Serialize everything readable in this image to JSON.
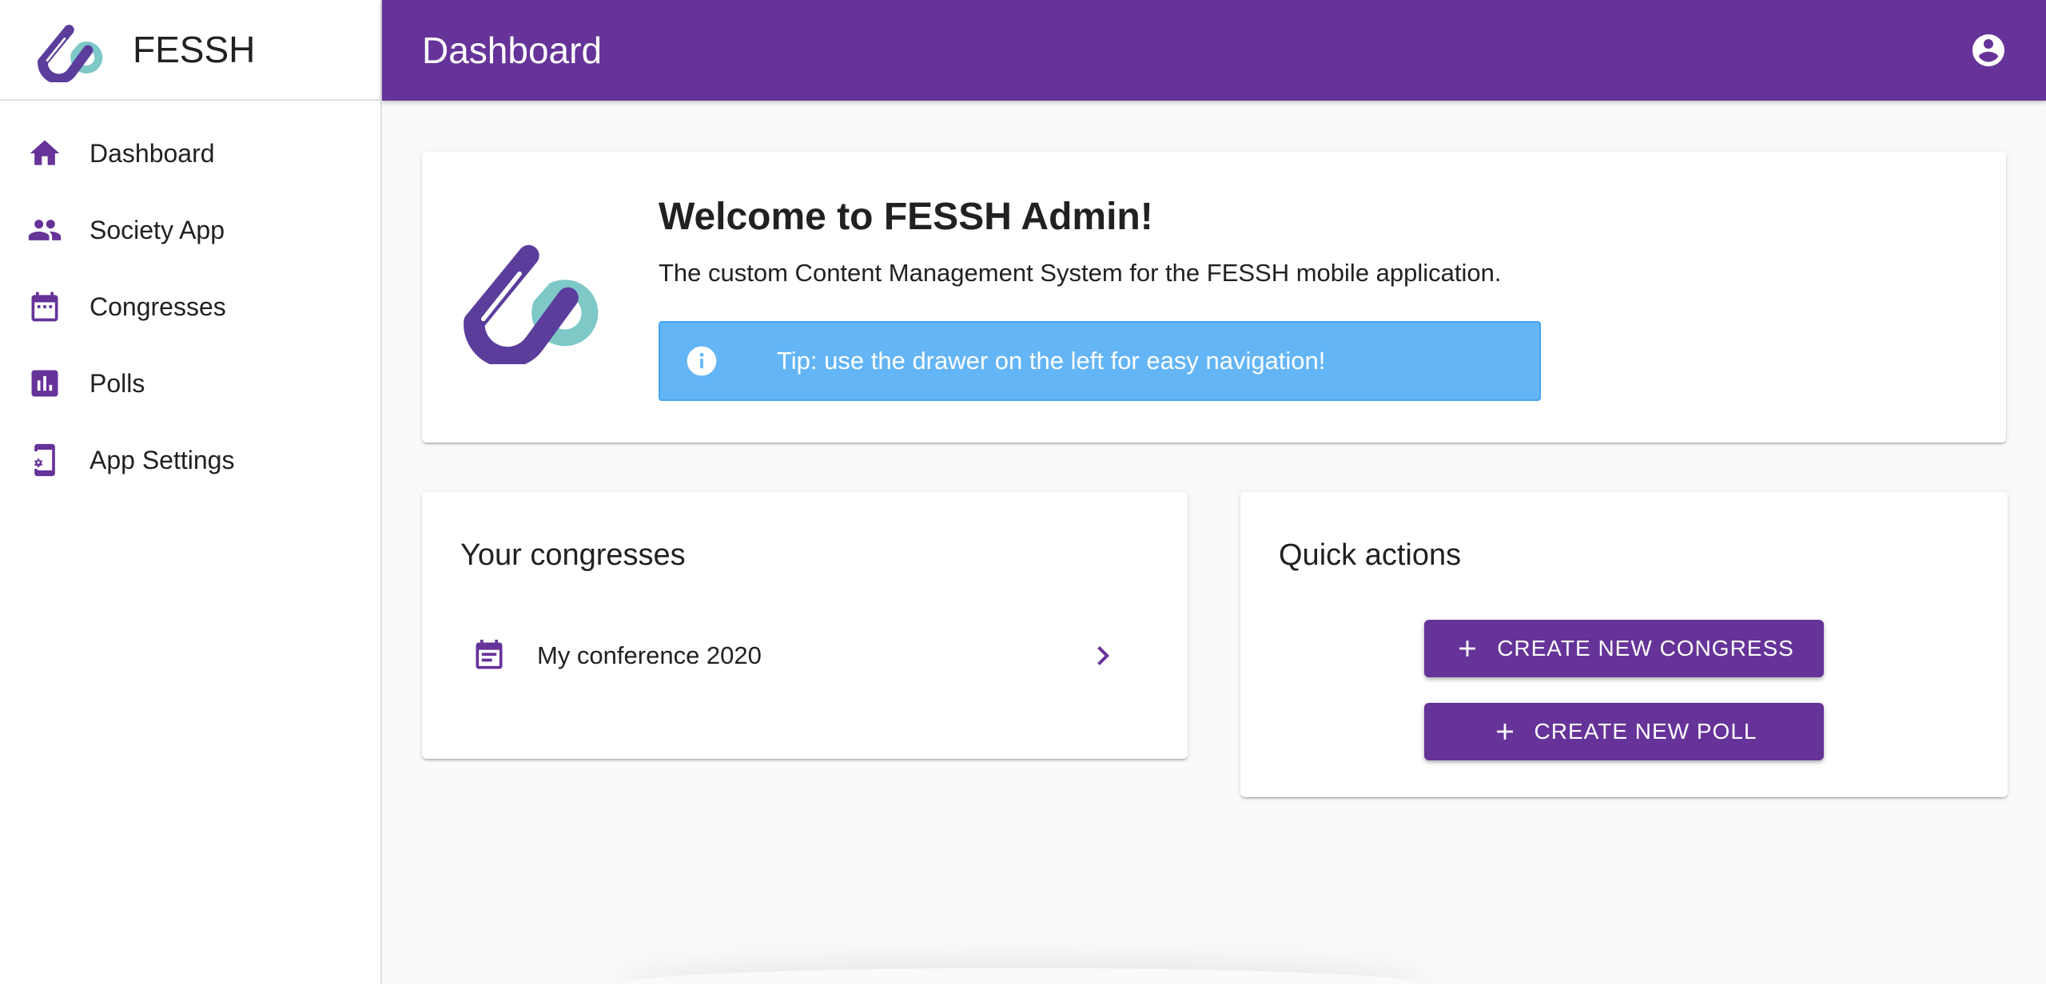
{
  "brand": {
    "name": "FESSH",
    "logo_icon": "fessh-hand-logo"
  },
  "nav": {
    "items": [
      {
        "label": "Dashboard",
        "icon": "home-icon"
      },
      {
        "label": "Society App",
        "icon": "people-icon"
      },
      {
        "label": "Congresses",
        "icon": "calendar-icon"
      },
      {
        "label": "Polls",
        "icon": "poll-icon"
      },
      {
        "label": "App Settings",
        "icon": "phone-settings-icon"
      }
    ]
  },
  "appbar": {
    "title": "Dashboard",
    "account_icon": "account-circle-icon"
  },
  "welcome": {
    "title": "Welcome to FESSH Admin!",
    "subtitle": "The custom Content Management System for the FESSH mobile application.",
    "tip": "Tip: use the drawer on the left for easy navigation!"
  },
  "congresses": {
    "title": "Your congresses",
    "items": [
      {
        "label": "My conference 2020"
      }
    ]
  },
  "quick_actions": {
    "title": "Quick actions",
    "create_congress": "CREATE NEW CONGRESS",
    "create_poll": "CREATE NEW POLL"
  },
  "colors": {
    "primary": "#663399",
    "tip_background": "#64b5f6",
    "logo_teal": "#7ec8c8",
    "logo_purple": "#5b3d9c"
  }
}
